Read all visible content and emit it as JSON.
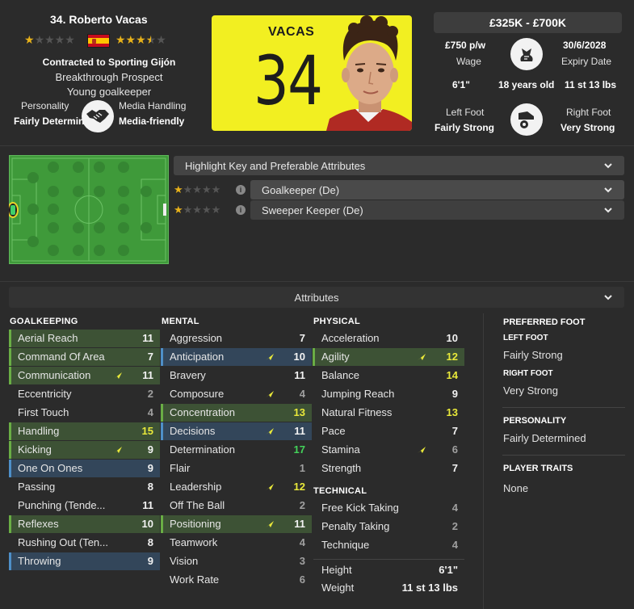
{
  "player": {
    "name": "34. Roberto Vacas",
    "current_ability_stars": 1,
    "potential_ability_stars": 3.5,
    "nationality": "Spain",
    "contract": "Contracted to Sporting Gijón",
    "prospect": "Breakthrough Prospect",
    "role_desc": "Young goalkeeper",
    "personality_label": "Personality",
    "personality_value": "Fairly Determined",
    "media_label": "Media Handling",
    "media_value": "Media-friendly"
  },
  "kit": {
    "name": "VACAS",
    "number": "34",
    "color": "#f2ef21"
  },
  "info": {
    "value_range": "£325K - £700K",
    "wage": "£750 p/w",
    "wage_label": "Wage",
    "expiry": "30/6/2028",
    "expiry_label": "Expiry Date",
    "height": "6'1\"",
    "age": "18 years old",
    "weight": "11 st 13 lbs",
    "left_foot_label": "Left Foot",
    "left_foot": "Fairly Strong",
    "right_foot_label": "Right Foot",
    "right_foot": "Very Strong"
  },
  "roles": {
    "header": "Highlight Key and Preferable Attributes",
    "items": [
      {
        "name": "Goalkeeper (De)",
        "stars": 1
      },
      {
        "name": "Sweeper Keeper (De)",
        "stars": 1
      }
    ]
  },
  "attributes": {
    "title": "Attributes",
    "goalkeeping": {
      "title": "GOALKEEPING",
      "rows": [
        {
          "name": "Aerial Reach",
          "value": "11",
          "hl": "green",
          "color": "white",
          "arrow": false
        },
        {
          "name": "Command Of Area",
          "value": "7",
          "hl": "green",
          "color": "white",
          "arrow": false
        },
        {
          "name": "Communication",
          "value": "11",
          "hl": "green",
          "color": "white",
          "arrow": true
        },
        {
          "name": "Eccentricity",
          "value": "2",
          "hl": "none",
          "color": "grey",
          "arrow": false
        },
        {
          "name": "First Touch",
          "value": "4",
          "hl": "none",
          "color": "grey",
          "arrow": false
        },
        {
          "name": "Handling",
          "value": "15",
          "hl": "green",
          "color": "yellow",
          "arrow": false
        },
        {
          "name": "Kicking",
          "value": "9",
          "hl": "green",
          "color": "white",
          "arrow": true
        },
        {
          "name": "One On Ones",
          "value": "9",
          "hl": "blue",
          "color": "white",
          "arrow": false
        },
        {
          "name": "Passing",
          "value": "8",
          "hl": "none",
          "color": "white",
          "arrow": false
        },
        {
          "name": "Punching (Tende...",
          "value": "11",
          "hl": "none",
          "color": "white",
          "arrow": false
        },
        {
          "name": "Reflexes",
          "value": "10",
          "hl": "green",
          "color": "white",
          "arrow": false
        },
        {
          "name": "Rushing Out (Ten...",
          "value": "8",
          "hl": "none",
          "color": "white",
          "arrow": false
        },
        {
          "name": "Throwing",
          "value": "9",
          "hl": "blue",
          "color": "white",
          "arrow": false
        }
      ]
    },
    "mental": {
      "title": "MENTAL",
      "rows": [
        {
          "name": "Aggression",
          "value": "7",
          "hl": "none",
          "color": "white",
          "arrow": false
        },
        {
          "name": "Anticipation",
          "value": "10",
          "hl": "blue",
          "color": "white",
          "arrow": true
        },
        {
          "name": "Bravery",
          "value": "11",
          "hl": "none",
          "color": "white",
          "arrow": false
        },
        {
          "name": "Composure",
          "value": "4",
          "hl": "none",
          "color": "grey",
          "arrow": true
        },
        {
          "name": "Concentration",
          "value": "13",
          "hl": "green",
          "color": "yellow",
          "arrow": false
        },
        {
          "name": "Decisions",
          "value": "11",
          "hl": "blue",
          "color": "white",
          "arrow": true
        },
        {
          "name": "Determination",
          "value": "17",
          "hl": "none",
          "color": "green",
          "arrow": false
        },
        {
          "name": "Flair",
          "value": "1",
          "hl": "none",
          "color": "grey",
          "arrow": false
        },
        {
          "name": "Leadership",
          "value": "12",
          "hl": "none",
          "color": "yellow",
          "arrow": true
        },
        {
          "name": "Off The Ball",
          "value": "2",
          "hl": "none",
          "color": "grey",
          "arrow": false
        },
        {
          "name": "Positioning",
          "value": "11",
          "hl": "green",
          "color": "white",
          "arrow": true
        },
        {
          "name": "Teamwork",
          "value": "4",
          "hl": "none",
          "color": "grey",
          "arrow": false
        },
        {
          "name": "Vision",
          "value": "3",
          "hl": "none",
          "color": "grey",
          "arrow": false
        },
        {
          "name": "Work Rate",
          "value": "6",
          "hl": "none",
          "color": "grey",
          "arrow": false
        }
      ]
    },
    "physical": {
      "title": "PHYSICAL",
      "rows": [
        {
          "name": "Acceleration",
          "value": "10",
          "hl": "none",
          "color": "white",
          "arrow": false
        },
        {
          "name": "Agility",
          "value": "12",
          "hl": "green",
          "color": "yellow",
          "arrow": true
        },
        {
          "name": "Balance",
          "value": "14",
          "hl": "none",
          "color": "yellow",
          "arrow": false
        },
        {
          "name": "Jumping Reach",
          "value": "9",
          "hl": "none",
          "color": "white",
          "arrow": false
        },
        {
          "name": "Natural Fitness",
          "value": "13",
          "hl": "none",
          "color": "yellow",
          "arrow": false
        },
        {
          "name": "Pace",
          "value": "7",
          "hl": "none",
          "color": "white",
          "arrow": false
        },
        {
          "name": "Stamina",
          "value": "6",
          "hl": "none",
          "color": "grey",
          "arrow": true
        },
        {
          "name": "Strength",
          "value": "7",
          "hl": "none",
          "color": "white",
          "arrow": false
        }
      ]
    },
    "technical": {
      "title": "TECHNICAL",
      "rows": [
        {
          "name": "Free Kick Taking",
          "value": "4",
          "hl": "none",
          "color": "grey",
          "arrow": false
        },
        {
          "name": "Penalty Taking",
          "value": "2",
          "hl": "none",
          "color": "grey",
          "arrow": false
        },
        {
          "name": "Technique",
          "value": "4",
          "hl": "none",
          "color": "grey",
          "arrow": false
        }
      ]
    },
    "body": {
      "rows": [
        {
          "name": "Height",
          "value": "6'1\""
        },
        {
          "name": "Weight",
          "value": "11 st 13 lbs"
        }
      ]
    }
  },
  "sidebar": {
    "preferred_foot_title": "PREFERRED FOOT",
    "left_foot_label": "LEFT FOOT",
    "left_foot_value": "Fairly Strong",
    "right_foot_label": "RIGHT FOOT",
    "right_foot_value": "Very Strong",
    "personality_title": "PERSONALITY",
    "personality_value": "Fairly Determined",
    "traits_title": "PLAYER TRAITS",
    "traits_value": "None"
  }
}
